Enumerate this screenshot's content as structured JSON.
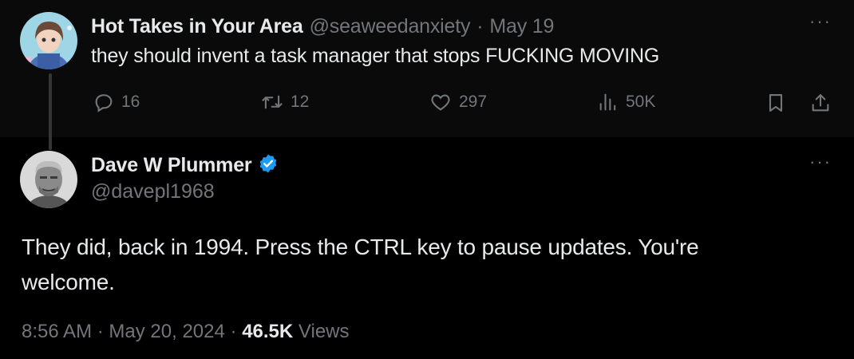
{
  "parent_tweet": {
    "display_name": "Hot Takes in Your Area",
    "handle": "@seaweedanxiety",
    "separator": "·",
    "date": "May 19",
    "text": "they should invent a task manager that stops FUCKING MOVING",
    "more_label": "···",
    "actions": {
      "replies": "16",
      "retweets": "12",
      "likes": "297",
      "views": "50K"
    }
  },
  "reply_tweet": {
    "display_name": "Dave W Plummer",
    "handle": "@davepl1968",
    "verified": true,
    "text_line1": "They did, back in 1994.  Press the CTRL key to pause updates.  You're",
    "text_line2": "welcome.",
    "time": "8:56 AM",
    "separator": "·",
    "date": "May 20, 2024",
    "views_count": "46.5K",
    "views_label": "Views",
    "more_label": "···"
  },
  "colors": {
    "background": "#000000",
    "text_primary": "#e7e9ea",
    "text_secondary": "#71767b",
    "verified_badge": "#1d9bf0"
  }
}
